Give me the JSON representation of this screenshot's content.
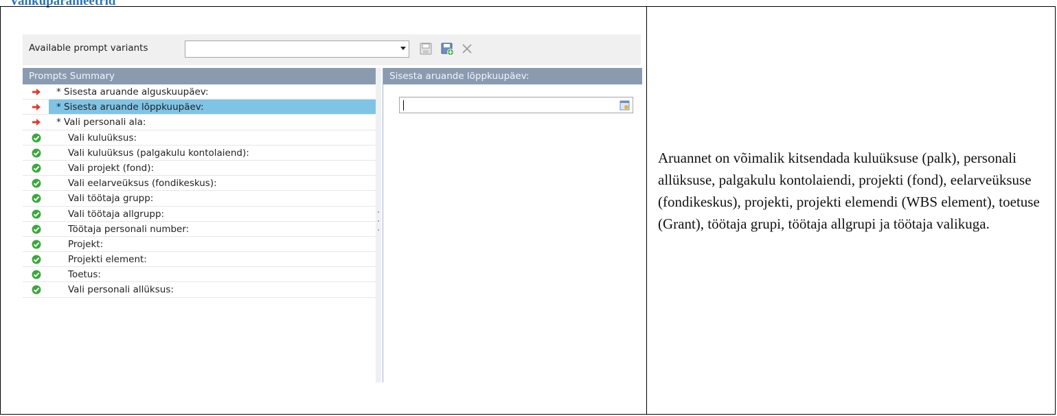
{
  "doc": {
    "heading_fragment": "Valikuparameetrid",
    "description": "Aruannet on võimalik kitsendada kuluüksuse (palk), personali allüksuse, palgakulu kontolaiendi, projekti (fond), eelarveüksuse (fondikeskus), projekti, projekti elemendi (WBS element), toetuse (Grant), töötaja grupi, töötaja allgrupi ja töötaja valikuga."
  },
  "toolbar": {
    "variants_label": "Available prompt variants",
    "variant_value": "",
    "icons": [
      "save-icon",
      "save-as-icon",
      "delete-icon"
    ]
  },
  "prompts_summary": {
    "title": "Prompts Summary",
    "items": [
      {
        "label": "* Sisesta aruande alguskuupäev:",
        "status": "required",
        "icon": "red-arrow-icon"
      },
      {
        "label": "* Sisesta aruande lõppkuupäev:",
        "status": "required",
        "icon": "red-arrow-icon"
      },
      {
        "label": "* Vali personali ala:",
        "status": "required",
        "icon": "red-arrow-icon"
      },
      {
        "label": "Vali kuluüksus:",
        "status": "ok",
        "icon": "green-check-icon"
      },
      {
        "label": "Vali kuluüksus (palgakulu kontolaiend):",
        "status": "ok",
        "icon": "green-check-icon"
      },
      {
        "label": "Vali projekt (fond):",
        "status": "ok",
        "icon": "green-check-icon"
      },
      {
        "label": "Vali eelarveüksus (fondikeskus):",
        "status": "ok",
        "icon": "green-check-icon"
      },
      {
        "label": "Vali töötaja grupp:",
        "status": "ok",
        "icon": "green-check-icon"
      },
      {
        "label": "Vali töötaja allgrupp:",
        "status": "ok",
        "icon": "green-check-icon"
      },
      {
        "label": "Töötaja personali number:",
        "status": "ok",
        "icon": "green-check-icon"
      },
      {
        "label": "Projekt:",
        "status": "ok",
        "icon": "green-check-icon"
      },
      {
        "label": "Projekti element:",
        "status": "ok",
        "icon": "green-check-icon"
      },
      {
        "label": "Toetus:",
        "status": "ok",
        "icon": "green-check-icon"
      },
      {
        "label": "Vali personali allüksus:",
        "status": "ok",
        "icon": "green-check-icon"
      }
    ],
    "selected_index": 1
  },
  "detail_panel": {
    "title": "Sisesta aruande lõppkuupäev:",
    "date_value": "",
    "calendar_icon": "calendar-icon"
  },
  "colors": {
    "panel_header": "#8a9bb0",
    "selected_row": "#7fc4e6",
    "required_arrow": "#e03a2e",
    "ok_check": "#3aa83a",
    "heading": "#2e74b5"
  }
}
